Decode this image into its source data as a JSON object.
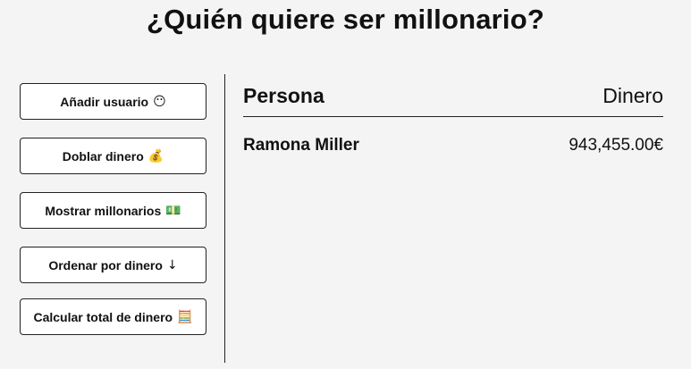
{
  "title": "¿Quién quiere ser millonario?",
  "sidebar": {
    "buttons": [
      {
        "label": "Añadir usuario",
        "icon": "😶",
        "icon_name": "user-face-icon"
      },
      {
        "label": "Doblar dinero",
        "icon": "💰",
        "icon_name": "money-bag-icon"
      },
      {
        "label": "Mostrar millonarios",
        "icon": "💵",
        "icon_name": "banknote-icon"
      },
      {
        "label": "Ordenar por dinero",
        "icon": "↓",
        "icon_name": "arrow-down-icon"
      },
      {
        "label": "Calcular total de dinero",
        "icon": "🧮",
        "icon_name": "abacus-icon"
      }
    ]
  },
  "table": {
    "headers": {
      "person": "Persona",
      "money": "Dinero"
    },
    "rows": [
      {
        "person": "Ramona Miller",
        "money": "943,455.00€"
      }
    ]
  }
}
